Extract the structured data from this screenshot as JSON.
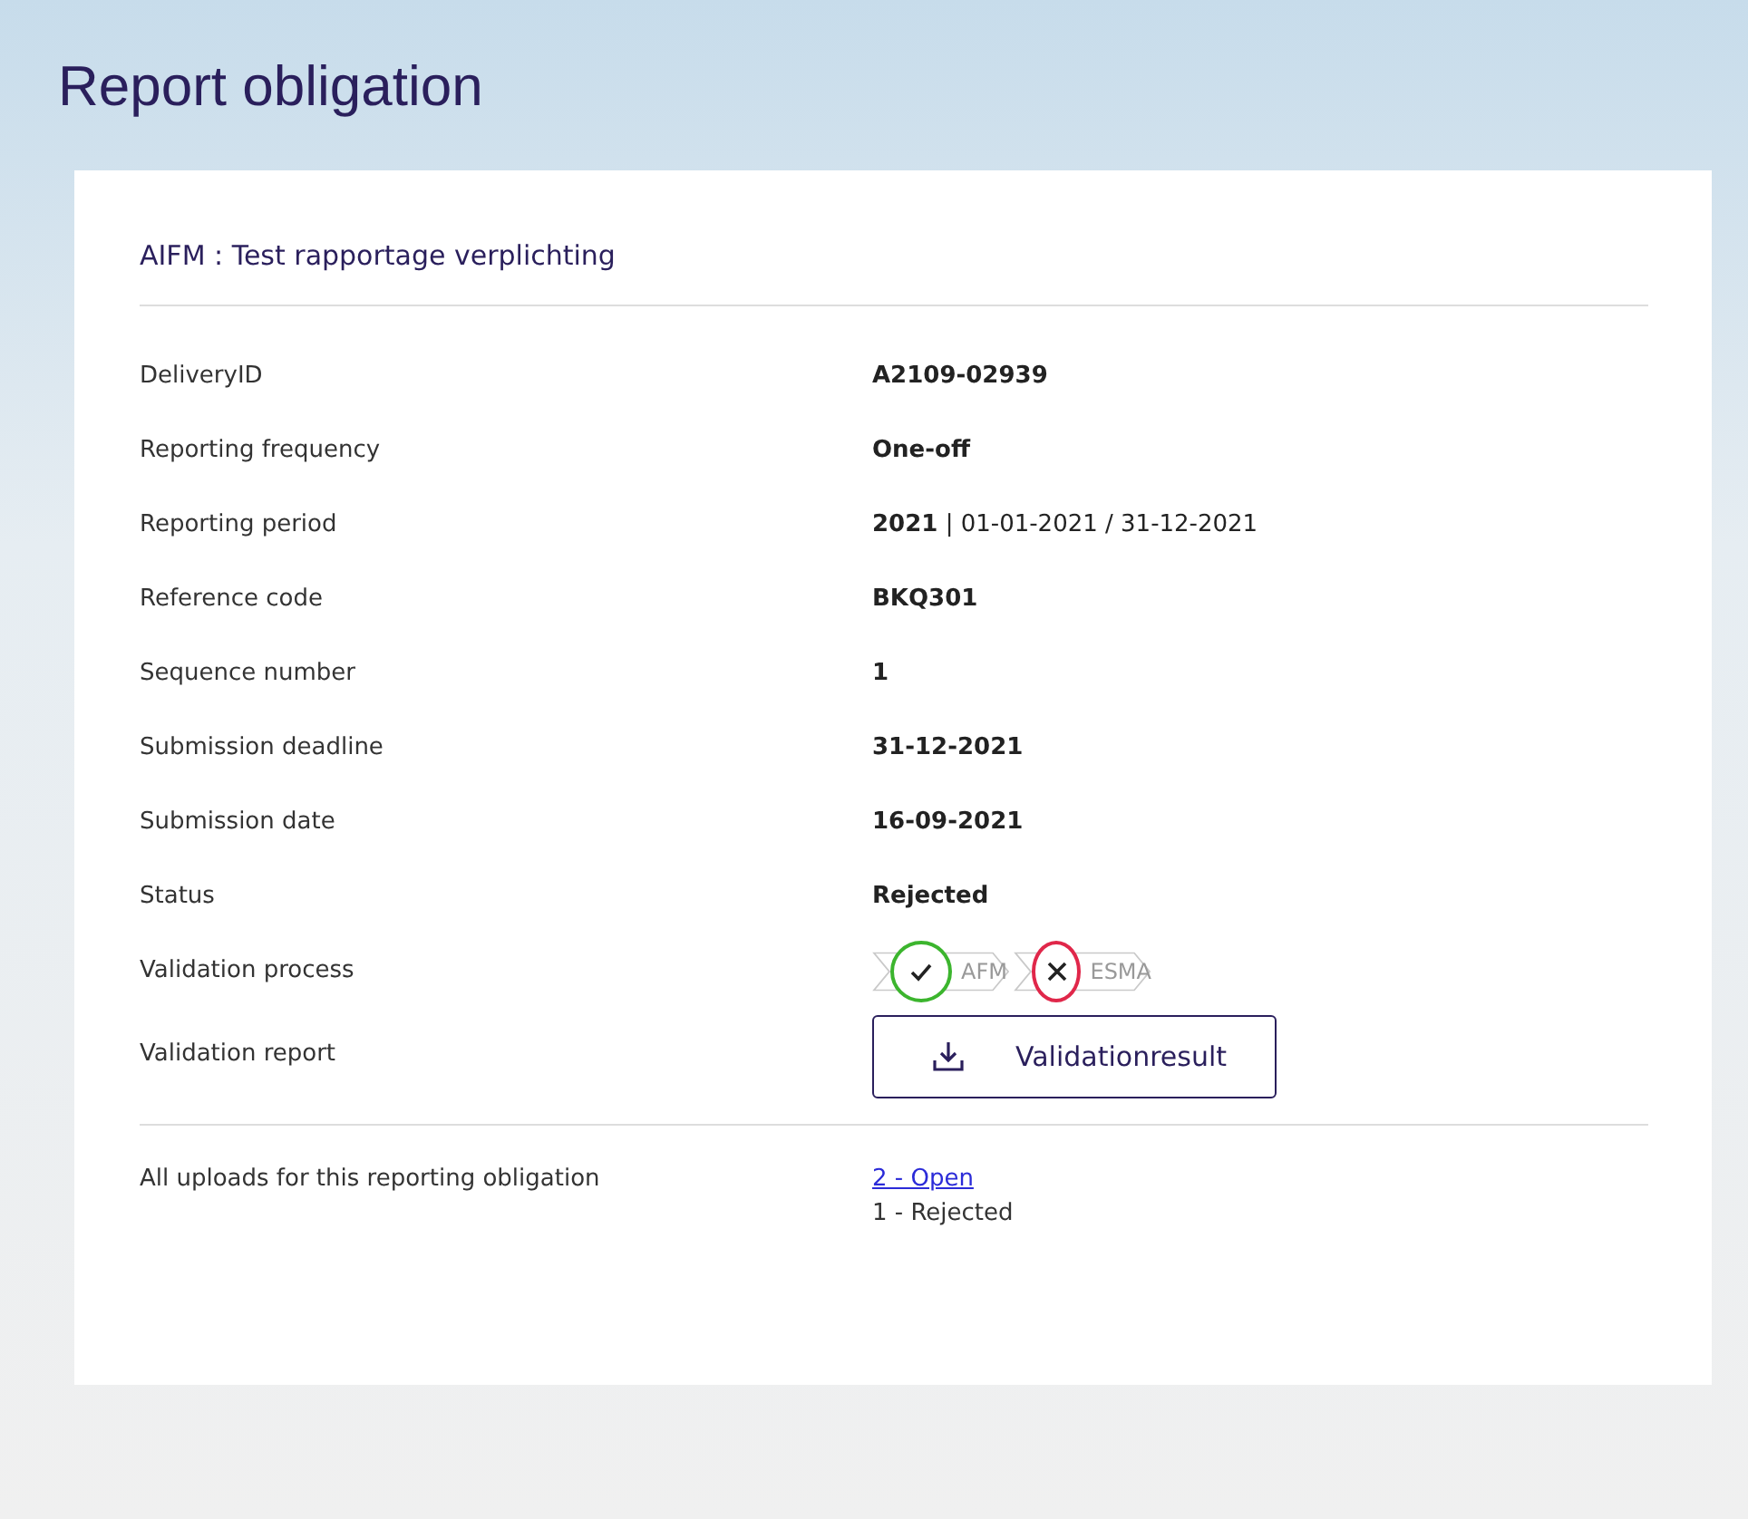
{
  "title": "Report obligation",
  "card": {
    "heading": "AIFM : Test rapportage verplichting",
    "fields": [
      {
        "kind": "text",
        "label": "DeliveryID",
        "value": "A2109-02939"
      },
      {
        "kind": "text",
        "label": "Reporting frequency",
        "value": "One-off"
      },
      {
        "kind": "rich",
        "label": "Reporting period",
        "value": "**2021** | 01-01-2021 / 31-12-2021"
      },
      {
        "kind": "text",
        "label": "Reference code",
        "value": "BKQ301"
      },
      {
        "kind": "text",
        "label": "Sequence number",
        "value": "1"
      },
      {
        "kind": "text",
        "label": "Submission deadline",
        "value": "31-12-2021"
      },
      {
        "kind": "text",
        "label": "Submission date",
        "value": "16-09-2021"
      },
      {
        "kind": "text",
        "label": "Status",
        "value": "Rejected"
      },
      {
        "kind": "steps",
        "label": "Validation process",
        "steps": [
          {
            "label": "AFM",
            "passed": true
          },
          {
            "label": "ESMA",
            "passed": false
          }
        ]
      },
      {
        "kind": "button",
        "label": "Validation report",
        "value": "Validationresult"
      }
    ],
    "uploads": {
      "label": "All uploads for this reporting obligation",
      "items": [
        {
          "kind": "link",
          "text": "2 - Open"
        },
        {
          "kind": "text",
          "text": "1 - Rejected"
        }
      ]
    }
  }
}
